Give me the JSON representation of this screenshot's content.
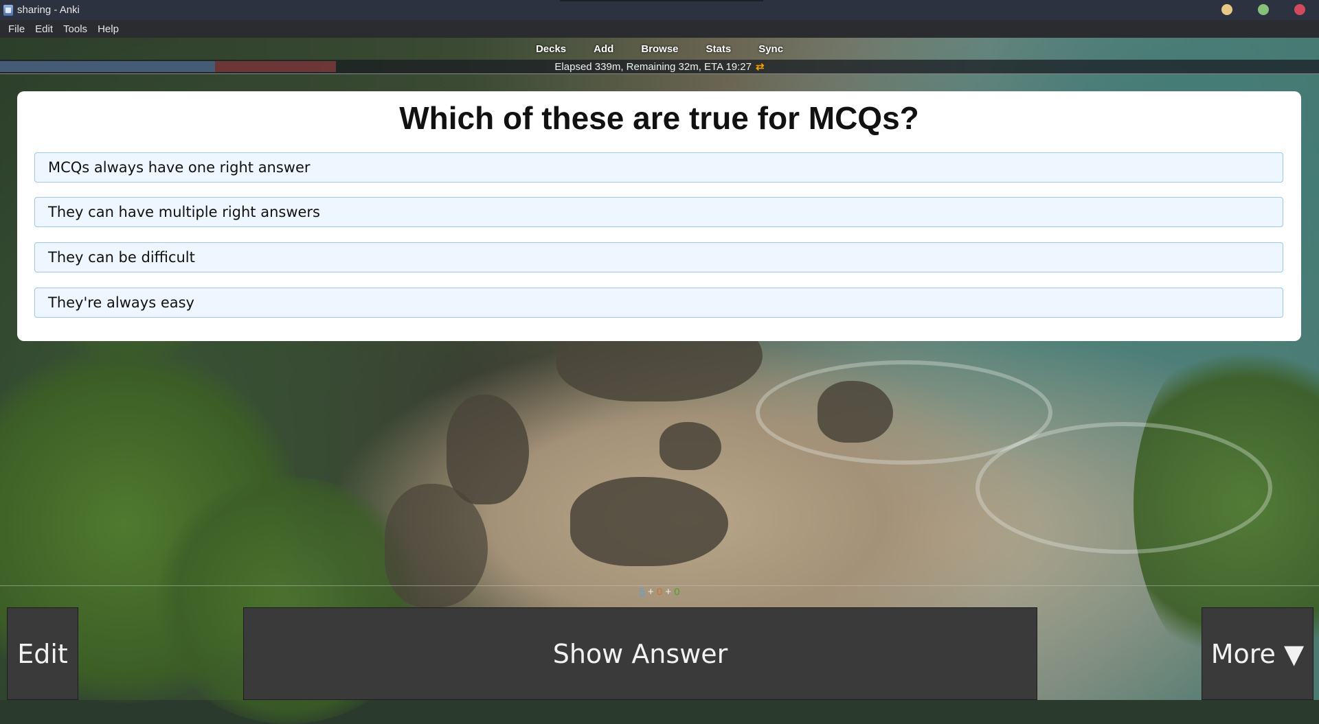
{
  "window": {
    "title": "sharing - Anki",
    "dot_colors": [
      "#e8c886",
      "#86c07a",
      "#d24b5c"
    ]
  },
  "menu": [
    "File",
    "Edit",
    "Tools",
    "Help"
  ],
  "nav": [
    "Decks",
    "Add",
    "Browse",
    "Stats",
    "Sync"
  ],
  "status": {
    "text": "Elapsed 339m, Remaining 32m, ETA 19:27",
    "sync_icon": "⇄",
    "progress_colors": [
      "#4e6a8a",
      "#7a3a3a"
    ]
  },
  "card": {
    "question": "Which of these are true for MCQs?",
    "options": [
      "MCQs always have one right answer",
      "They can have multiple right answers",
      "They can be difficult",
      "They're always easy"
    ]
  },
  "counts": {
    "new": "5",
    "learn": "0",
    "review": "0",
    "sep": "+"
  },
  "buttons": {
    "edit": "Edit",
    "show_answer": "Show Answer",
    "more": "More ▼"
  }
}
